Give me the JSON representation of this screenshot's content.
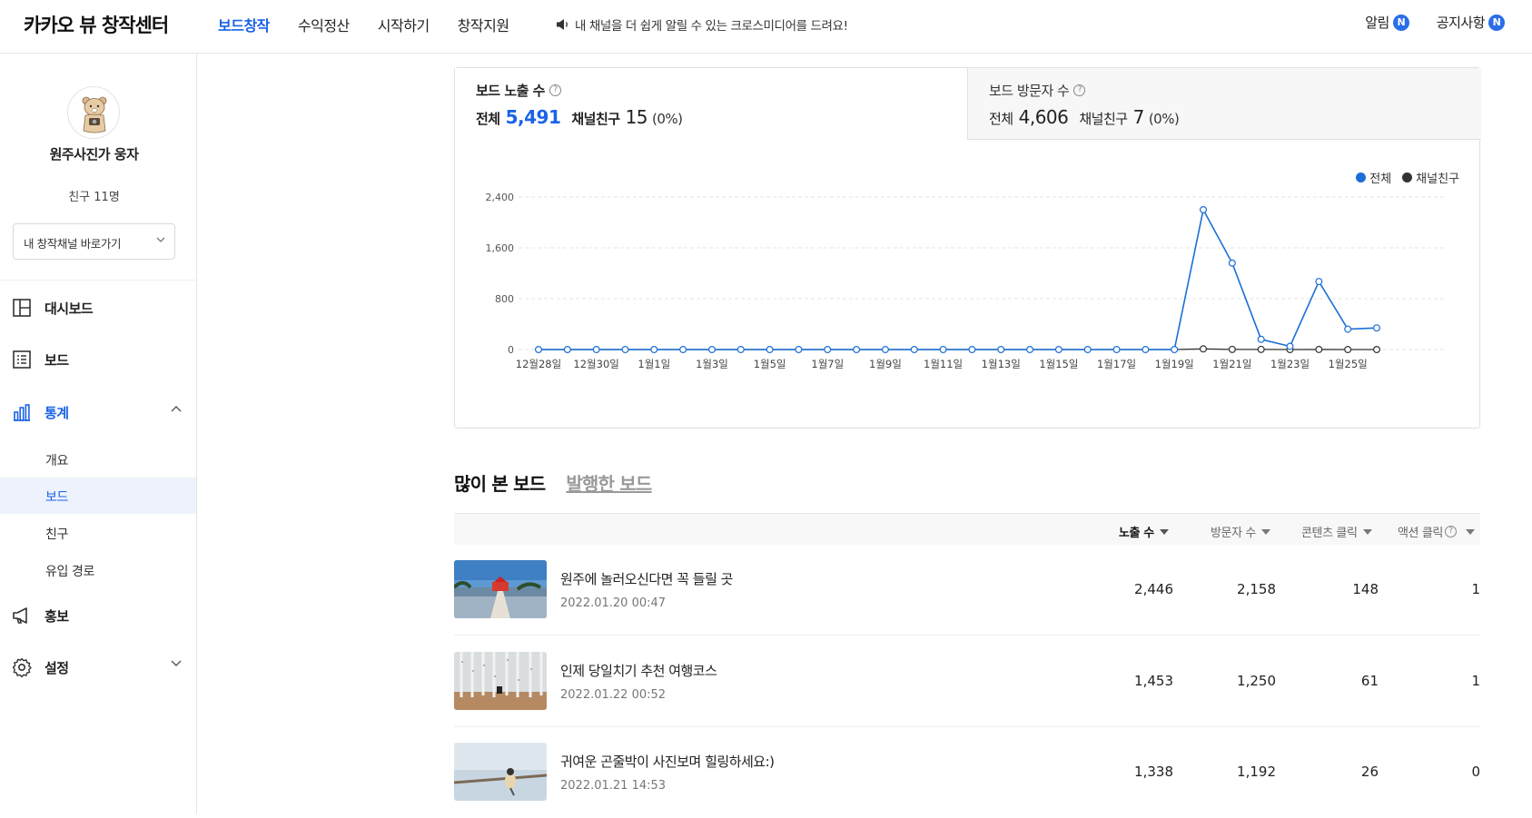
{
  "header": {
    "logo": "카카오 뷰 창작센터",
    "nav": [
      "보드창작",
      "수익정산",
      "시작하기",
      "창작지원"
    ],
    "notice": "내 채널을 더 쉽게 알릴 수 있는 크로스미디어를 드려요!",
    "alerts_label": "알림",
    "announcements_label": "공지사항",
    "badge": "N"
  },
  "sidebar": {
    "profile_name": "원주사진가 웅자",
    "friends": "친구 11명",
    "channel_select": "내 창작채널 바로가기",
    "menu": {
      "dashboard": "대시보드",
      "board": "보드",
      "stats": "통계",
      "promo": "홍보",
      "settings": "설정"
    },
    "stats_sub": [
      "개요",
      "보드",
      "친구",
      "유입 경로"
    ]
  },
  "cards": {
    "impressions": {
      "title": "보드 노출 수",
      "total_label": "전체",
      "total": "5,491",
      "friends_label": "채널친구",
      "friends": "15",
      "pct": "(0%)"
    },
    "visitors": {
      "title": "보드 방문자 수",
      "total_label": "전체",
      "total": "4,606",
      "friends_label": "채널친구",
      "friends": "7",
      "pct": "(0%)"
    },
    "help": "?"
  },
  "chart_data": {
    "type": "line",
    "categories": [
      "12월28일",
      "12월29일",
      "12월30일",
      "12월31일",
      "1월1일",
      "1월2일",
      "1월3일",
      "1월4일",
      "1월5일",
      "1월6일",
      "1월7일",
      "1월8일",
      "1월9일",
      "1월10일",
      "1월11일",
      "1월12일",
      "1월13일",
      "1월14일",
      "1월15일",
      "1월16일",
      "1월17일",
      "1월18일",
      "1월19일",
      "1월20일",
      "1월21일",
      "1월22일",
      "1월23일",
      "1월24일",
      "1월25일",
      "1월26일"
    ],
    "tick_labels": [
      "12월28일",
      "12월30일",
      "1월1일",
      "1월3일",
      "1월5일",
      "1월7일",
      "1월9일",
      "1월11일",
      "1월13일",
      "1월15일",
      "1월17일",
      "1월19일",
      "1월21일",
      "1월23일",
      "1월25일"
    ],
    "series": [
      {
        "name": "전체",
        "color": "#1a6fd6",
        "values": [
          0,
          0,
          0,
          0,
          0,
          0,
          0,
          0,
          0,
          0,
          0,
          0,
          0,
          0,
          0,
          0,
          0,
          0,
          0,
          0,
          0,
          0,
          0,
          2200,
          1360,
          160,
          50,
          1070,
          320,
          340
        ]
      },
      {
        "name": "채널친구",
        "color": "#333333",
        "values": [
          0,
          0,
          0,
          0,
          0,
          0,
          0,
          0,
          0,
          0,
          0,
          0,
          0,
          0,
          0,
          0,
          0,
          0,
          0,
          0,
          0,
          0,
          0,
          10,
          2,
          2,
          0,
          1,
          0,
          0
        ]
      }
    ],
    "yticks": [
      "0",
      "800",
      "1,600",
      "2,400"
    ],
    "ylim": [
      0,
      2400
    ],
    "grid": true,
    "legend": "top-right"
  },
  "tabs": {
    "popular": "많이 본 보드",
    "published": "발행한 보드"
  },
  "table": {
    "columns": [
      "노출 수",
      "방문자 수",
      "콘텐츠 클릭",
      "액션 클릭"
    ],
    "rows": [
      {
        "title": "원주에 놀러오신다면 꼭 들릴 곳",
        "date": "2022.01.20 00:47",
        "impressions": "2,446",
        "visitors": "2,158",
        "content_clicks": "148",
        "action_clicks": "1"
      },
      {
        "title": "인제 당일치기 추천 여행코스",
        "date": "2022.01.22 00:52",
        "impressions": "1,453",
        "visitors": "1,250",
        "content_clicks": "61",
        "action_clicks": "1"
      },
      {
        "title": "귀여운 곤줄박이 사진보며 힐링하세요:)",
        "date": "2022.01.21 14:53",
        "impressions": "1,338",
        "visitors": "1,192",
        "content_clicks": "26",
        "action_clicks": "0"
      }
    ]
  }
}
